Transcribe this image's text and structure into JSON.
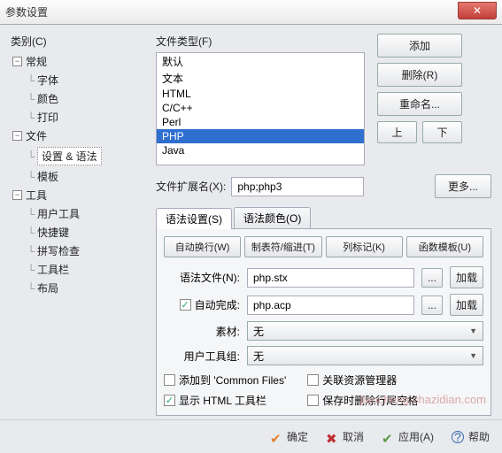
{
  "window": {
    "title": "参数设置"
  },
  "left": {
    "label": "类别(C)",
    "tree": {
      "general": {
        "label": "常规",
        "children": {
          "font": "字体",
          "color": "颜色",
          "print": "打印"
        }
      },
      "file": {
        "label": "文件",
        "children": {
          "settings_syntax": "设置 & 语法",
          "template": "模板"
        }
      },
      "tools": {
        "label": "工具",
        "children": {
          "user_tools": "用户工具",
          "shortcut": "快捷键",
          "spellcheck": "拼写检查",
          "toolbar": "工具栏",
          "layout": "布局"
        }
      }
    }
  },
  "filetypes": {
    "label": "文件类型(F)",
    "items": [
      "默认",
      "文本",
      "HTML",
      "C/C++",
      "Perl",
      "PHP",
      "Java"
    ],
    "selected": "PHP"
  },
  "side_buttons": {
    "add": "添加",
    "delete": "删除(R)",
    "rename": "重命名...",
    "up": "上",
    "down": "下"
  },
  "ext": {
    "label": "文件扩展名(X):",
    "value": "php;php3",
    "more": "更多..."
  },
  "tabs": {
    "syntax_settings": "语法设置(S)",
    "syntax_color": "语法颜色(O)"
  },
  "toolbar": {
    "autowrap": "自动换行(W)",
    "tabs_indent": "制表符/缩进(T)",
    "column_mark": "列标记(K)",
    "func_template": "函数模板(U)"
  },
  "form": {
    "syntax_file_label": "语法文件(N):",
    "syntax_file_value": "php.stx",
    "autocomplete_label": "自动完成:",
    "autocomplete_value": "php.acp",
    "autocomplete_checked": true,
    "material_label": "素材:",
    "material_value": "无",
    "usertool_label": "用户工具组:",
    "usertool_value": "无",
    "browse": "...",
    "load": "加载"
  },
  "checks": {
    "add_common": {
      "label": "添加到 'Common Files'",
      "checked": false
    },
    "show_html": {
      "label": "显示 HTML 工具栏",
      "checked": true
    },
    "assoc_explorer": {
      "label": "关联资源管理器",
      "checked": false
    },
    "trim_save": {
      "label": "保存时删除行尾空格",
      "checked": false
    }
  },
  "bottom": {
    "ok": "确定",
    "cancel": "取消",
    "apply": "应用(A)",
    "help": "帮助"
  },
  "watermark": "jiaocheng.chazidian.com"
}
